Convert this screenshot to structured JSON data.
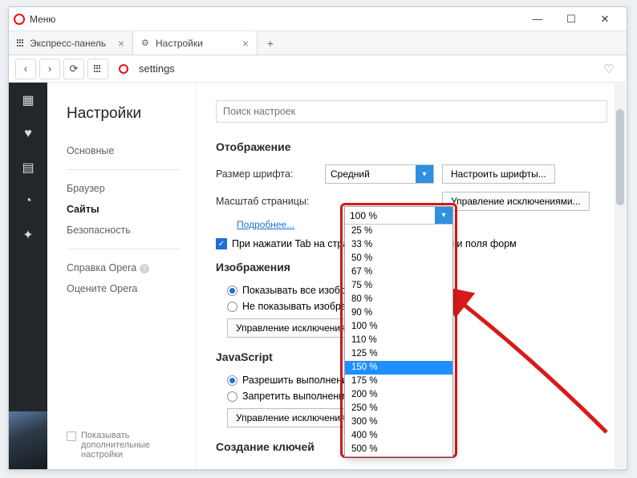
{
  "titlebar": {
    "menu": "Меню"
  },
  "tabs": {
    "speed_dial": "Экспресс-панель",
    "settings": "Настройки"
  },
  "address": {
    "url": "settings"
  },
  "sidebar": {
    "title": "Настройки",
    "items": [
      "Основные",
      "Браузер",
      "Сайты",
      "Безопасность"
    ],
    "help": "Справка Opera",
    "rate": "Оцените Opera",
    "show_advanced": "Показывать дополнительные настройки"
  },
  "content": {
    "search_placeholder": "Поиск настроек",
    "display_h": "Отображение",
    "font_size_lbl": "Размер шрифта:",
    "font_size_val": "Средний",
    "font_btn": "Настроить шрифты...",
    "scale_lbl": "Масштаб страницы:",
    "scale_val": "100 %",
    "exceptions_btn": "Управление исключениями...",
    "more": "Подробнее...",
    "tab_cb": "При нажатии Tab на странице выделять ссылки и поля форм",
    "images_h": "Изображения",
    "img_show": "Показывать все изображения",
    "img_hide": "Не показывать изображения",
    "manage_exc": "Управление исключениями...",
    "js_h": "JavaScript",
    "js_allow": "Разрешить выполнение JavaScript",
    "js_block": "Запретить выполнение JavaScript",
    "keys_h": "Создание ключей"
  },
  "zoom_options": [
    "25 %",
    "33 %",
    "50 %",
    "67 %",
    "75 %",
    "80 %",
    "90 %",
    "100 %",
    "110 %",
    "125 %",
    "150 %",
    "175 %",
    "200 %",
    "250 %",
    "300 %",
    "400 %",
    "500 %"
  ],
  "zoom_selected": "150 %"
}
